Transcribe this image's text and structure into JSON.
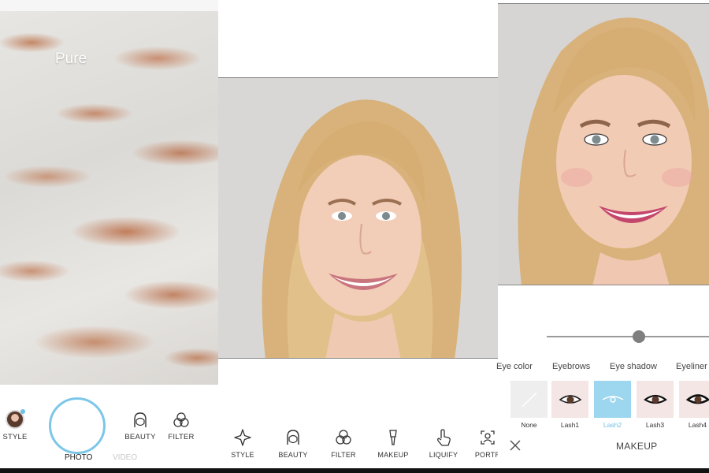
{
  "camera": {
    "filter_name": "Pure",
    "style_label": "STYLE",
    "beauty_label": "BEAUTY",
    "filter_label": "FILTER",
    "mode_photo": "PHOTO",
    "mode_video": "VIDEO"
  },
  "editor": {
    "tools": [
      {
        "label": "STYLE",
        "icon": "sparkle-icon"
      },
      {
        "label": "BEAUTY",
        "icon": "face-outline-icon"
      },
      {
        "label": "FILTER",
        "icon": "three-circles-icon"
      },
      {
        "label": "MAKEUP",
        "icon": "brush-icon"
      },
      {
        "label": "LIQUIFY",
        "icon": "hand-pointer-icon"
      },
      {
        "label": "PORTR",
        "icon": "portrait-icon"
      }
    ]
  },
  "makeup": {
    "intensity": 0.57,
    "categories": [
      "Eye color",
      "Eyebrows",
      "Eye shadow",
      "Eyeliner"
    ],
    "options": [
      {
        "name": "None",
        "selected": false
      },
      {
        "name": "Lash1",
        "selected": false
      },
      {
        "name": "Lash2",
        "selected": true
      },
      {
        "name": "Lash3",
        "selected": false
      },
      {
        "name": "Lash4",
        "selected": false
      }
    ],
    "title": "MAKEUP"
  },
  "colors": {
    "accent": "#7cc7e8",
    "selected_tile": "#9dd6ef",
    "tile_bg": "#f3e6e4"
  }
}
